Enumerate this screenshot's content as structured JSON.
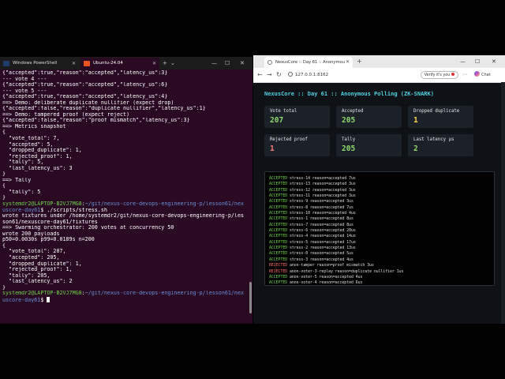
{
  "terminal": {
    "tabs": [
      {
        "label": "Windows PowerShell"
      },
      {
        "label": "Ubuntu-24.04"
      }
    ],
    "new_tab_symbol": "+",
    "dropdown_symbol": "⌄",
    "window_controls": {
      "minimize": "—",
      "maximize": "☐",
      "close": "✕"
    },
    "lines": [
      {
        "parts": [
          {
            "t": "{\"accepted\":true,\"reason\":\"accepted\",\"latency_us\":3}"
          }
        ]
      },
      {
        "parts": [
          {
            "t": "--- vote 4 ---"
          }
        ]
      },
      {
        "parts": [
          {
            "t": "{\"accepted\":true,\"reason\":\"accepted\",\"latency_us\":6}"
          }
        ]
      },
      {
        "parts": [
          {
            "t": "--- vote 5 ---"
          }
        ]
      },
      {
        "parts": [
          {
            "t": "{\"accepted\":true,\"reason\":\"accepted\",\"latency_us\":4}"
          }
        ]
      },
      {
        "parts": [
          {
            "t": "==> Demo: deliberate duplicate nullifier (expect drop)"
          }
        ]
      },
      {
        "parts": [
          {
            "t": "{\"accepted\":false,\"reason\":\"duplicate nullifier\",\"latency_us\":1}"
          }
        ]
      },
      {
        "parts": [
          {
            "t": "==> Demo: tampered proof (expect reject)"
          }
        ]
      },
      {
        "parts": [
          {
            "t": "{\"accepted\":false,\"reason\":\"proof mismatch\",\"latency_us\":3}"
          }
        ]
      },
      {
        "parts": [
          {
            "t": "==> Metrics snapshot"
          }
        ]
      },
      {
        "parts": [
          {
            "t": "{"
          }
        ]
      },
      {
        "parts": [
          {
            "t": "  \"vote_total\": 7,"
          }
        ]
      },
      {
        "parts": [
          {
            "t": "  \"accepted\": 5,"
          }
        ]
      },
      {
        "parts": [
          {
            "t": "  \"dropped_duplicate\": 1,"
          }
        ]
      },
      {
        "parts": [
          {
            "t": "  \"rejected_proof\": 1,"
          }
        ]
      },
      {
        "parts": [
          {
            "t": "  \"tally\": 5,"
          }
        ]
      },
      {
        "parts": [
          {
            "t": "  \"last_latency_us\": 3"
          }
        ]
      },
      {
        "parts": [
          {
            "t": "}"
          }
        ]
      },
      {
        "parts": [
          {
            "t": "==> Tally"
          }
        ]
      },
      {
        "parts": [
          {
            "t": "{"
          }
        ]
      },
      {
        "parts": [
          {
            "t": "  \"tally\": 5"
          }
        ]
      },
      {
        "parts": [
          {
            "t": "}"
          }
        ]
      },
      {
        "parts": [
          {
            "t": "systemdr2@LAPTOP-B2VJ7MG8",
            "c": "pg"
          },
          {
            "t": ":"
          },
          {
            "t": "~/git/nexus-core-devops-engineering-p/lesson61/nex",
            "c": "pb"
          }
        ]
      },
      {
        "parts": [
          {
            "t": "uscore-day61",
            "c": "pb"
          },
          {
            "t": "$ ./scripts/stress.sh"
          }
        ]
      },
      {
        "parts": [
          {
            "t": "wrote fixtures under /home/systemdr2/git/nexus-core-devops-engineering-p/les"
          }
        ]
      },
      {
        "parts": [
          {
            "t": "son61/nexuscore-day61/fixtures"
          }
        ]
      },
      {
        "parts": [
          {
            "t": "==> Swarming orchestrator: 200 votes at concurrency 50"
          }
        ]
      },
      {
        "parts": [
          {
            "t": "wrote 200 payloads"
          }
        ]
      },
      {
        "parts": [
          {
            "t": "p50=0.0030s p99=0.0189s n=200"
          }
        ]
      },
      {
        "parts": [
          {
            "t": "{"
          }
        ]
      },
      {
        "parts": [
          {
            "t": "  \"vote_total\": 207,"
          }
        ]
      },
      {
        "parts": [
          {
            "t": "  \"accepted\": 205,"
          }
        ]
      },
      {
        "parts": [
          {
            "t": "  \"dropped_duplicate\": 1,"
          }
        ]
      },
      {
        "parts": [
          {
            "t": "  \"rejected_proof\": 1,"
          }
        ]
      },
      {
        "parts": [
          {
            "t": "  \"tally\": 205,"
          }
        ]
      },
      {
        "parts": [
          {
            "t": "  \"last_latency_us\": 2"
          }
        ]
      },
      {
        "parts": [
          {
            "t": "}"
          }
        ]
      },
      {
        "parts": [
          {
            "t": "systemdr2@LAPTOP-B2VJ7MG8",
            "c": "pg"
          },
          {
            "t": ":"
          },
          {
            "t": "~/git/nexus-core-devops-engineering-p/lesson61/nex",
            "c": "pb"
          }
        ]
      },
      {
        "parts": [
          {
            "t": "uscore-day61",
            "c": "pb"
          },
          {
            "t": "$ "
          }
        ],
        "cursor": true
      }
    ]
  },
  "browser": {
    "tab_title": "NexusCore :: Day 61 :: Anonymou",
    "tab_close": "✕",
    "new_tab": "+",
    "window_controls": {
      "minimize": "—",
      "maximize": "☐",
      "close": "✕"
    },
    "nav": {
      "back": "←",
      "forward": "→",
      "refresh": "↻"
    },
    "url": "127.0.0.1:8162",
    "verify_label": "Verify it's you",
    "chat_label": "Chat",
    "more_symbol": "⋯",
    "page_title": "NexusCore :: Day 61 :: Anonymous Polling (ZK-SNARK)",
    "cards": [
      {
        "label": "Vote total",
        "value": "207",
        "color": "#8fd96a"
      },
      {
        "label": "Accepted",
        "value": "205",
        "color": "#8fd96a"
      },
      {
        "label": "Dropped duplicate",
        "value": "1",
        "color": "#ffd54f"
      },
      {
        "label": "Rejected proof",
        "value": "1",
        "color": "#ff7a7a"
      },
      {
        "label": "Tally",
        "value": "205",
        "color": "#8fd96a"
      },
      {
        "label": "Last latency µs",
        "value": "2",
        "color": "#8fd96a"
      }
    ],
    "log": [
      {
        "status": "ACCEPTED",
        "text": " stress-14 reason=accepted 7us"
      },
      {
        "status": "ACCEPTED",
        "text": " stress-13 reason=accepted 3us"
      },
      {
        "status": "ACCEPTED",
        "text": " stress-12 reason=accepted 3us"
      },
      {
        "status": "ACCEPTED",
        "text": " stress-11 reason=accepted 3us"
      },
      {
        "status": "ACCEPTED",
        "text": " stress-9 reason=accepted 3us"
      },
      {
        "status": "ACCEPTED",
        "text": " stress-8 reason=accepted 7us"
      },
      {
        "status": "ACCEPTED",
        "text": " stress-10 reason=accepted 4us"
      },
      {
        "status": "ACCEPTED",
        "text": " stress-1 reason=accepted 8us"
      },
      {
        "status": "ACCEPTED",
        "text": " stress-7 reason=accepted 8us"
      },
      {
        "status": "ACCEPTED",
        "text": " stress-6 reason=accepted 20us"
      },
      {
        "status": "ACCEPTED",
        "text": " stress-4 reason=accepted 14us"
      },
      {
        "status": "ACCEPTED",
        "text": " stress-5 reason=accepted 17us"
      },
      {
        "status": "ACCEPTED",
        "text": " stress-2 reason=accepted 13us"
      },
      {
        "status": "ACCEPTED",
        "text": " stress-0 reason=accepted 5us"
      },
      {
        "status": "ACCEPTED",
        "text": " stress-3 reason=accepted 4us"
      },
      {
        "status": "REJECTED",
        "text": " anon-tamper reason=proof mismatch 3us"
      },
      {
        "status": "REJECTED",
        "text": " anon-voter-3-replay reason=duplicate nullifier 1us"
      },
      {
        "status": "ACCEPTED",
        "text": " anon-voter-5 reason=accepted 4us"
      },
      {
        "status": "ACCEPTED",
        "text": " anon-voter-4 reason=accepted 6us"
      }
    ]
  }
}
